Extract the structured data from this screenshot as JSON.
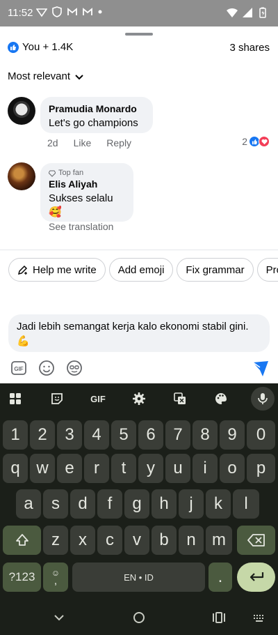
{
  "status_bar": {
    "time": "11:52"
  },
  "post_sheet": {
    "reactions_summary": "You + 1.4K",
    "shares": "3 shares",
    "sort_label": "Most relevant"
  },
  "comments": [
    {
      "author": "Pramudia Monardo",
      "text": "Let's go champions",
      "time": "2d",
      "like_label": "Like",
      "reply_label": "Reply",
      "reaction_count": "2"
    },
    {
      "badge": "Top fan",
      "author": "Elis Aliyah",
      "text": "Sukses selalu🥰",
      "translation_label": "See translation"
    }
  ],
  "compose": {
    "chips": [
      "Help me write",
      "Add emoji",
      "Fix grammar",
      "Pro"
    ],
    "input_text": "Jadi lebih semangat kerja kalo ekonomi stabil gini. 💪"
  },
  "keyboard": {
    "gif_label": "GIF",
    "number_row": [
      "1",
      "2",
      "3",
      "4",
      "5",
      "6",
      "7",
      "8",
      "9",
      "0"
    ],
    "row_1": [
      "q",
      "w",
      "e",
      "r",
      "t",
      "y",
      "u",
      "i",
      "o",
      "p"
    ],
    "row_2": [
      "a",
      "s",
      "d",
      "f",
      "g",
      "h",
      "j",
      "k",
      "l"
    ],
    "row_3": [
      "z",
      "x",
      "c",
      "v",
      "b",
      "n",
      "m"
    ],
    "symbols_label": "?123",
    "comma_label": ",",
    "space_label": "EN • ID",
    "period_label": "."
  }
}
